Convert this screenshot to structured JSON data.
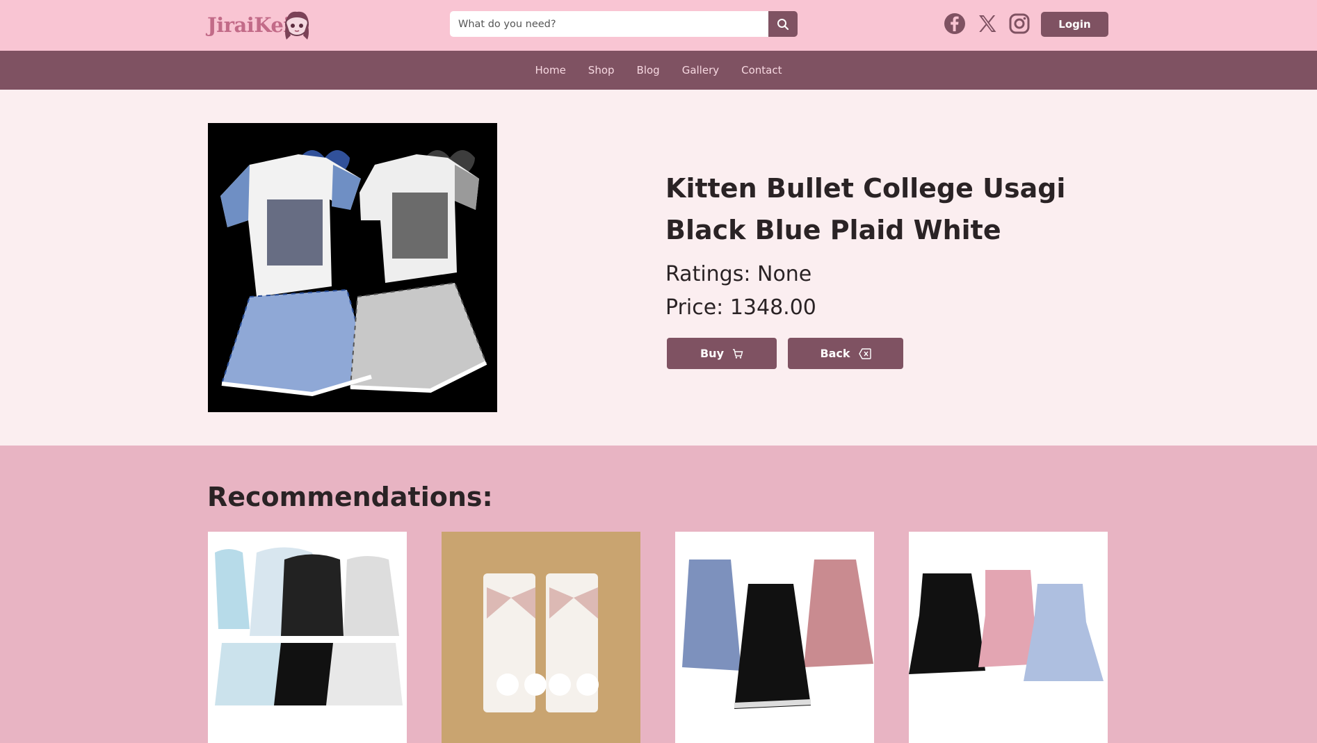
{
  "header": {
    "logo_text": "JiraiKei",
    "search_placeholder": "What do you need?",
    "login_label": "Login"
  },
  "nav": {
    "items": [
      "Home",
      "Shop",
      "Blog",
      "Gallery",
      "Contact"
    ]
  },
  "product": {
    "title": "Kitten Bullet College Usagi Black Blue Plaid White",
    "rating_text": "Ratings: None",
    "price_text": "Price: 1348.00",
    "buy_label": "Buy",
    "back_label": "Back"
  },
  "recommendations": {
    "title": "Recommendations:"
  },
  "colors": {
    "header_bg": "#f9c5d3",
    "nav_bg": "#7f5262",
    "product_bg": "#fbeef0",
    "rec_bg": "#e8b4c3",
    "accent": "#7f5262"
  }
}
